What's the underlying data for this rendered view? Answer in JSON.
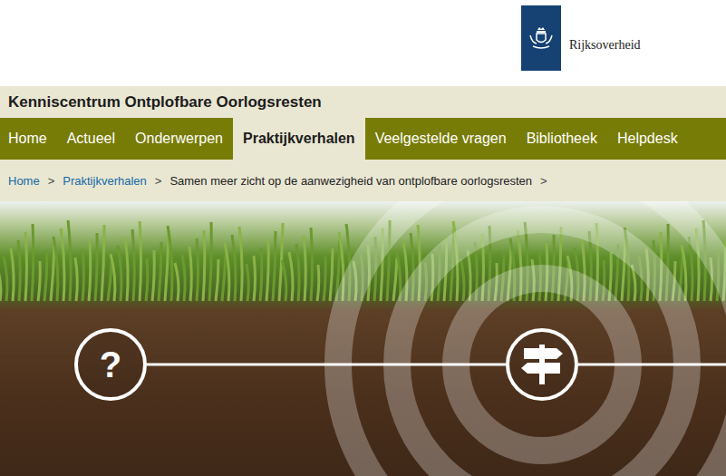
{
  "header": {
    "logo_text": "Rijksoverheid"
  },
  "site_title": "Kenniscentrum Ontplofbare Oorlogsresten",
  "nav": [
    {
      "label": "Home",
      "selected": false
    },
    {
      "label": "Actueel",
      "selected": false
    },
    {
      "label": "Onderwerpen",
      "selected": false
    },
    {
      "label": "Praktijkverhalen",
      "selected": true
    },
    {
      "label": "Veelgestelde vragen",
      "selected": false
    },
    {
      "label": "Bibliotheek",
      "selected": false
    },
    {
      "label": "Helpdesk",
      "selected": false
    }
  ],
  "breadcrumb": {
    "separator": ">",
    "items": [
      {
        "label": "Home",
        "kind": "link"
      },
      {
        "label": "Praktijkverhalen",
        "kind": "link"
      },
      {
        "label": "Samen meer zicht op de aanwezigheid van ontplofbare oorlogsresten",
        "kind": "current"
      }
    ]
  },
  "hero": {
    "question_icon": "?"
  }
}
